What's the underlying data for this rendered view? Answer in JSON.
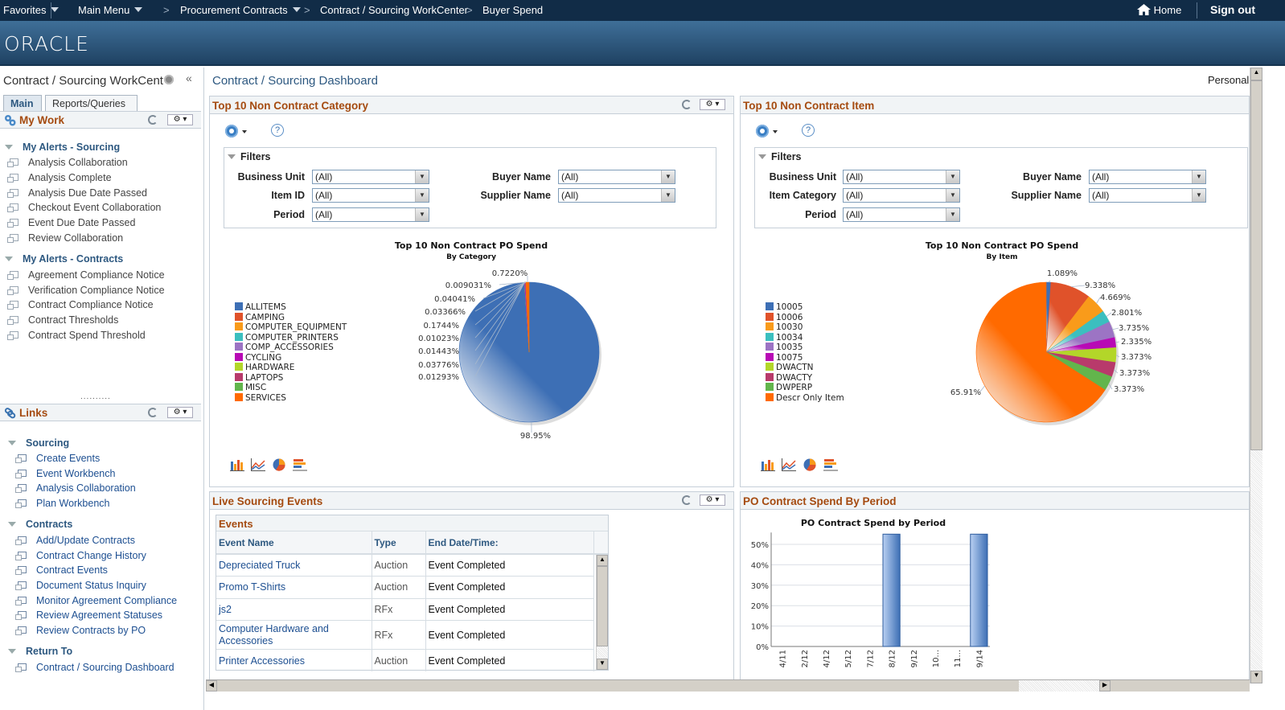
{
  "topnav": {
    "favorites": "Favorites",
    "main_menu": "Main Menu",
    "breadcrumbs": [
      "Procurement Contracts",
      "Contract / Sourcing WorkCenter",
      "Buyer Spend"
    ],
    "home": "Home",
    "sign_out": "Sign out"
  },
  "brand": {
    "logo": "ORACLE"
  },
  "sidebar": {
    "title": "Contract / Sourcing WorkCent",
    "tabs": [
      {
        "label": "Main",
        "active": true
      },
      {
        "label": "Reports/Queries",
        "active": false
      }
    ],
    "my_work": {
      "title": "My Work",
      "sections": [
        {
          "label": "My Alerts - Sourcing",
          "items": [
            "Analysis Collaboration",
            "Analysis Complete",
            "Analysis Due Date Passed",
            "Checkout Event Collaboration",
            "Event Due Date Passed",
            "Review Collaboration"
          ]
        },
        {
          "label": "My Alerts - Contracts",
          "items": [
            "Agreement Compliance Notice",
            "Verification Compliance Notice",
            "Contract Compliance Notice",
            "Contract Thresholds",
            "Contract Spend Threshold"
          ]
        }
      ]
    },
    "links": {
      "title": "Links",
      "sections": [
        {
          "label": "Sourcing",
          "items": [
            "Create Events",
            "Event Workbench",
            "Analysis Collaboration",
            "Plan Workbench"
          ]
        },
        {
          "label": "Contracts",
          "items": [
            "Add/Update Contracts",
            "Contract Change History",
            "Contract Events",
            "Document Status Inquiry",
            "Monitor Agreement Compliance",
            "Review Agreement Statuses",
            "Review Contracts by PO"
          ]
        },
        {
          "label": "Return To",
          "items": [
            "Contract / Sourcing Dashboard"
          ]
        }
      ]
    }
  },
  "main": {
    "title": "Contract / Sourcing Dashboard",
    "personalize": "Personali",
    "filters_label": "Filters",
    "help_label": "?",
    "category_pagelet": {
      "title": "Top 10 Non Contract Category",
      "filters": [
        {
          "label": "Business Unit",
          "value": "(All)"
        },
        {
          "label": "Item ID",
          "value": "(All)"
        },
        {
          "label": "Period",
          "value": "(All)"
        },
        {
          "label": "Buyer Name",
          "value": "(All)"
        },
        {
          "label": "Supplier Name",
          "value": "(All)"
        }
      ]
    },
    "item_pagelet": {
      "title": "Top 10 Non Contract Item",
      "filters": [
        {
          "label": "Business Unit",
          "value": "(All)"
        },
        {
          "label": "Item Category",
          "value": "(All)"
        },
        {
          "label": "Period",
          "value": "(All)"
        },
        {
          "label": "Buyer Name",
          "value": "(All)"
        },
        {
          "label": "Supplier Name",
          "value": "(All)"
        }
      ]
    },
    "events_pagelet": {
      "title": "Live Sourcing Events",
      "box_title": "Events",
      "columns": [
        "Event Name",
        "Type",
        "End Date/Time:"
      ],
      "rows": [
        {
          "name": "Depreciated Truck",
          "type": "Auction",
          "end": "Event Completed"
        },
        {
          "name": "Promo T-Shirts",
          "type": "Auction",
          "end": "Event Completed"
        },
        {
          "name": "js2",
          "type": "RFx",
          "end": "Event Completed"
        },
        {
          "name": "Computer Hardware and Accessories",
          "type": "RFx",
          "end": "Event Completed"
        },
        {
          "name": "Printer Accessories",
          "type": "Auction",
          "end": "Event Completed"
        }
      ]
    },
    "period_pagelet": {
      "title": "PO Contract Spend By Period"
    },
    "colors": {
      "accent_title": "#a54b10",
      "link": "#1d4f91",
      "nav_bg": "#112c47"
    }
  },
  "chart_data": [
    {
      "type": "pie",
      "title": "Top 10 Non Contract PO Spend",
      "subtitle": "By Category",
      "legend_position": "left",
      "labels": [
        "ALLITEMS",
        "CAMPING",
        "COMPUTER_EQUIPMENT",
        "COMPUTER_PRINTERS",
        "COMP_ACCESSORIES",
        "CYCLING",
        "HARDWARE",
        "LAPTOPS",
        "MISC",
        "SERVICES"
      ],
      "values": [
        98.95,
        0.01293,
        0.03776,
        0.01443,
        0.01023,
        0.1744,
        0.03366,
        0.04041,
        0.009031,
        0.722
      ],
      "value_labels": [
        "98.95%",
        "0.01293%",
        "0.03776%",
        "0.01443%",
        "0.01023%",
        "0.1744%",
        "0.03366%",
        "0.04041%",
        "0.009031%",
        "0.7220%"
      ],
      "colors": [
        "#3d6fb5",
        "#e0522a",
        "#f99b1a",
        "#3bbfbf",
        "#9c74c4",
        "#b80ab5",
        "#b3d629",
        "#b83a6b",
        "#62b54c",
        "#ff6a00"
      ]
    },
    {
      "type": "pie",
      "title": "Top 10 Non Contract PO Spend",
      "subtitle": "By Item",
      "legend_position": "left",
      "labels": [
        "10005",
        "10006",
        "10030",
        "10034",
        "10035",
        "10075",
        "DWACTN",
        "DWACTY",
        "DWPERP",
        "Descr Only Item"
      ],
      "values": [
        1.089,
        9.338,
        4.669,
        2.801,
        3.735,
        2.335,
        3.373,
        3.373,
        3.373,
        65.91
      ],
      "value_labels": [
        "1.089%",
        "9.338%",
        "4.669%",
        "2.801%",
        "3.735%",
        "2.335%",
        "3.373%",
        "3.373%",
        "3.373%",
        "65.91%"
      ],
      "colors": [
        "#3d6fb5",
        "#e0522a",
        "#f99b1a",
        "#3bbfbf",
        "#9c74c4",
        "#b80ab5",
        "#b3d629",
        "#b83a6b",
        "#62b54c",
        "#ff6a00"
      ]
    },
    {
      "type": "bar",
      "title": "PO Contract Spend by Period",
      "categories": [
        "4/11",
        "2/12",
        "4/12",
        "5/12",
        "7/12",
        "8/12",
        "9/12",
        "10...",
        "11...",
        "9/14"
      ],
      "values": [
        0,
        0,
        0,
        0,
        0,
        55,
        0,
        0,
        0,
        55
      ],
      "yticks": [
        "0%",
        "10%",
        "20%",
        "30%",
        "40%",
        "50%"
      ],
      "ylim": [
        0,
        55
      ],
      "xlabel": "",
      "ylabel": "",
      "grid": true,
      "color": "#3d6fb5"
    }
  ]
}
